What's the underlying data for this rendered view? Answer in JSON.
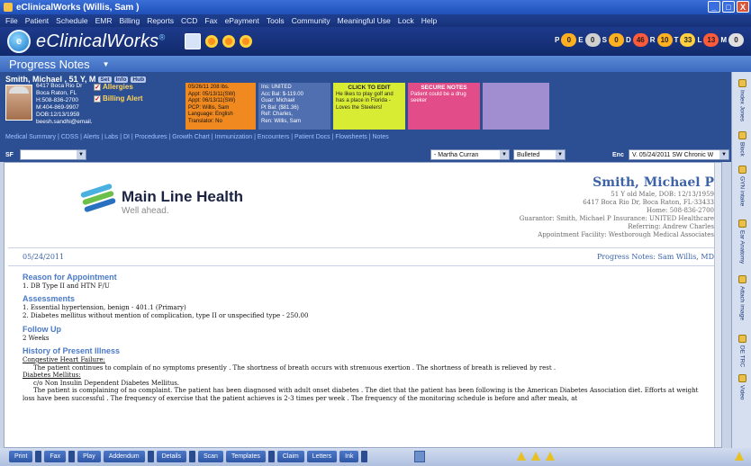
{
  "window": {
    "title": "eClinicalWorks (Willis, Sam )",
    "controls": [
      "_",
      "□",
      "X"
    ]
  },
  "menu": [
    "File",
    "Patient",
    "Schedule",
    "EMR",
    "Billing",
    "Reports",
    "CCD",
    "Fax",
    "ePayment",
    "Tools",
    "Community",
    "Meaningful Use",
    "Lock",
    "Help"
  ],
  "brand": {
    "name": "eClinicalWorks",
    "mark": "®"
  },
  "jellybeans": [
    {
      "letter": "P",
      "count": "0",
      "color": "#ffb020"
    },
    {
      "letter": "E",
      "count": "0",
      "color": "#d0d0d0"
    },
    {
      "letter": "S",
      "count": "0",
      "color": "#ffb020"
    },
    {
      "letter": "D",
      "count": "46",
      "color": "#ff5a3a"
    },
    {
      "letter": "R",
      "count": "10",
      "color": "#ffb020"
    },
    {
      "letter": "T",
      "count": "33",
      "color": "#ffd040"
    },
    {
      "letter": "L",
      "count": "13",
      "color": "#ff5a3a"
    },
    {
      "letter": "M",
      "count": "0",
      "color": "#e0e0e0"
    }
  ],
  "module": {
    "title": "Progress Notes"
  },
  "patient": {
    "name": "Smith, Michael , 51 Y, M",
    "tags": [
      "Set",
      "Info",
      "Hub"
    ],
    "address": [
      "6417 Boca Rio Dr",
      "Boca Raton, FL",
      "H:508-836-2700",
      "M:404-869-9907",
      "DOB:12/13/1959",
      "beesh.sandhi@email."
    ],
    "alerts": [
      "Allergies",
      "Billing Alert"
    ],
    "appt": [
      "05/26/11 208 lbs.",
      "Appt: 05/13/11(SW)",
      "Appt: 06/13/11(SW)",
      "PCP: Willis, Sam",
      "Language: English",
      "Translator: No"
    ],
    "ins": [
      "Ins: UNITED",
      "Acc Bal: $-119.00",
      "Guar: Michael",
      "Pt Bal: ($81.36)",
      "Ref: Charles,",
      "Ren: Willis, Sam"
    ],
    "click_to_edit": {
      "title": "CLICK TO EDIT",
      "text": "He likes to play golf and has a place in Florida - Loves the Steelers!"
    },
    "secure_notes": {
      "title": "SECURE NOTES",
      "text": "Patient could be a drug seeker"
    },
    "links": "Medical Summary | CDSS | Alerts | Labs | DI | Procedures | Growth Chart | Immunization | Encounters | Patient Docs | Flowsheets | Notes"
  },
  "sf": {
    "label": "SF",
    "provider": "- Martha Curran",
    "format": "Bulleted",
    "enc_label": "Enc",
    "encounter": "V. 05/24/2011 SW Chronic W"
  },
  "document": {
    "org_name": "Main Line Health",
    "org_tagline": "Well ahead.",
    "org_colors": [
      "#4ab0e0",
      "#6cc04a",
      "#2a70c0"
    ],
    "patient_name": "Smith, Michael P",
    "patient_lines": [
      "51 Y old Male, DOB: 12/13/1959",
      "6417 Boca Rio Dr, Boca Raton, FL-33433",
      "Home: 508-836-2700",
      "Guarantor: Smith, Michael P  Insurance: UNITED Healthcare",
      "Referring: Andrew Charles",
      "Appointment Facility: Westborough Medical Associates"
    ],
    "date": "05/24/2011",
    "notes_title": "Progress Notes:  Sam Willis, MD",
    "reason_h": "Reason for Appointment",
    "reason": "1. DB Type II and HTN F/U",
    "assess_h": "Assessments",
    "assess": [
      "1. Essential hypertension, benign - 401.1 (Primary)",
      "2. Diabetes mellitus without mention of complication, type II or unspecified type - 250.00"
    ],
    "follow_h": "Follow Up",
    "follow": "2 Weeks",
    "hpi_h": "History of Present Illness",
    "hpi_chf": "Congestive Heart Failure:",
    "hpi_chf_text": "The patient continues to complain of no symptoms presently . The shortness of breath occurs with strenuous exertion . The shortness of breath is relieved by rest .",
    "hpi_dm": "Diabetes Mellitus:",
    "hpi_dm_co": "c/o Non Insulin Dependent Diabetes Mellitus.",
    "hpi_dm_text": "The patient is complaining of no complaint. The patient has been diagnosed with adult onset diabetes . The diet that the patient has been following is the American Diabetes Association diet. Efforts at weight loss have been successful . The frequency of exercise that the patient achieves is 2-3 times per week . The frequency of the monitoring schedule is before and after meals, at"
  },
  "right_tabs": [
    "Index Jones",
    "Block",
    "GYN intake",
    "Ear Anatomy",
    "Attach image",
    "DE TRC",
    "Video"
  ],
  "toolbar": [
    "Print",
    "Fax",
    "Play",
    "Addendum",
    "Details",
    "Scan",
    "Templates",
    "Claim",
    "Letters",
    "Ink"
  ]
}
